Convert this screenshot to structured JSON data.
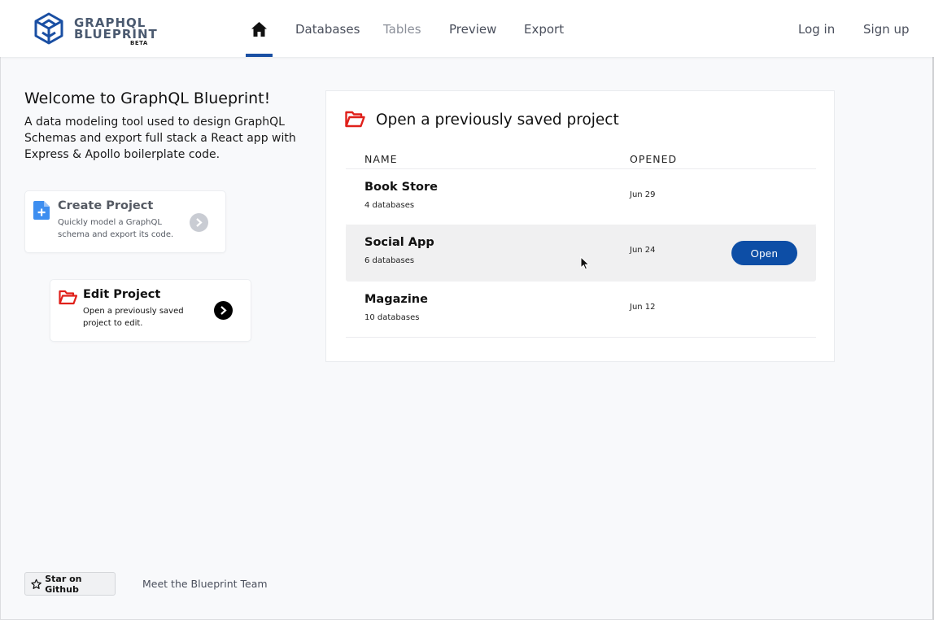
{
  "header": {
    "logo": {
      "line1": "GRAPHQL",
      "line2": "BLUEPRINT",
      "badge": "BETA",
      "icon": "cube-logo-icon"
    },
    "nav": {
      "home_icon": "home-icon",
      "items": [
        {
          "label": "Databases"
        },
        {
          "label": "Tables"
        },
        {
          "label": "Preview"
        },
        {
          "label": "Export"
        }
      ],
      "login": "Log in",
      "signup": "Sign up"
    },
    "accent_color": "#1a4fa3"
  },
  "welcome": {
    "title": "Welcome to GraphQL Blueprint!",
    "description": "A data modeling tool used to design GraphQL Schemas and export full stack a React app with Express & Apollo boilerplate code."
  },
  "cards": {
    "create": {
      "title": "Create Project",
      "description": "Quickly model a GraphQL schema and export its code.",
      "icon": "file-plus-icon"
    },
    "edit": {
      "title": "Edit Project",
      "description": "Open a previously saved project to edit.",
      "icon": "folder-open-icon"
    }
  },
  "projects_panel": {
    "title": "Open a previously saved project",
    "columns": {
      "name": "NAME",
      "opened": "OPENED"
    },
    "rows": [
      {
        "name": "Book Store",
        "databases": "4 databases",
        "opened": "Jun 29"
      },
      {
        "name": "Social App",
        "databases": "6 databases",
        "opened": "Jun 24",
        "action": "Open"
      },
      {
        "name": "Magazine",
        "databases": "10 databases",
        "opened": "Jun 12"
      }
    ]
  },
  "footer": {
    "github_button": "Star on Github",
    "team_link": "Meet the Blueprint Team"
  },
  "colors": {
    "primary_button": "#0d4ea6",
    "folder_icon": "#e0201a",
    "file_icon": "#3d8ef0"
  }
}
